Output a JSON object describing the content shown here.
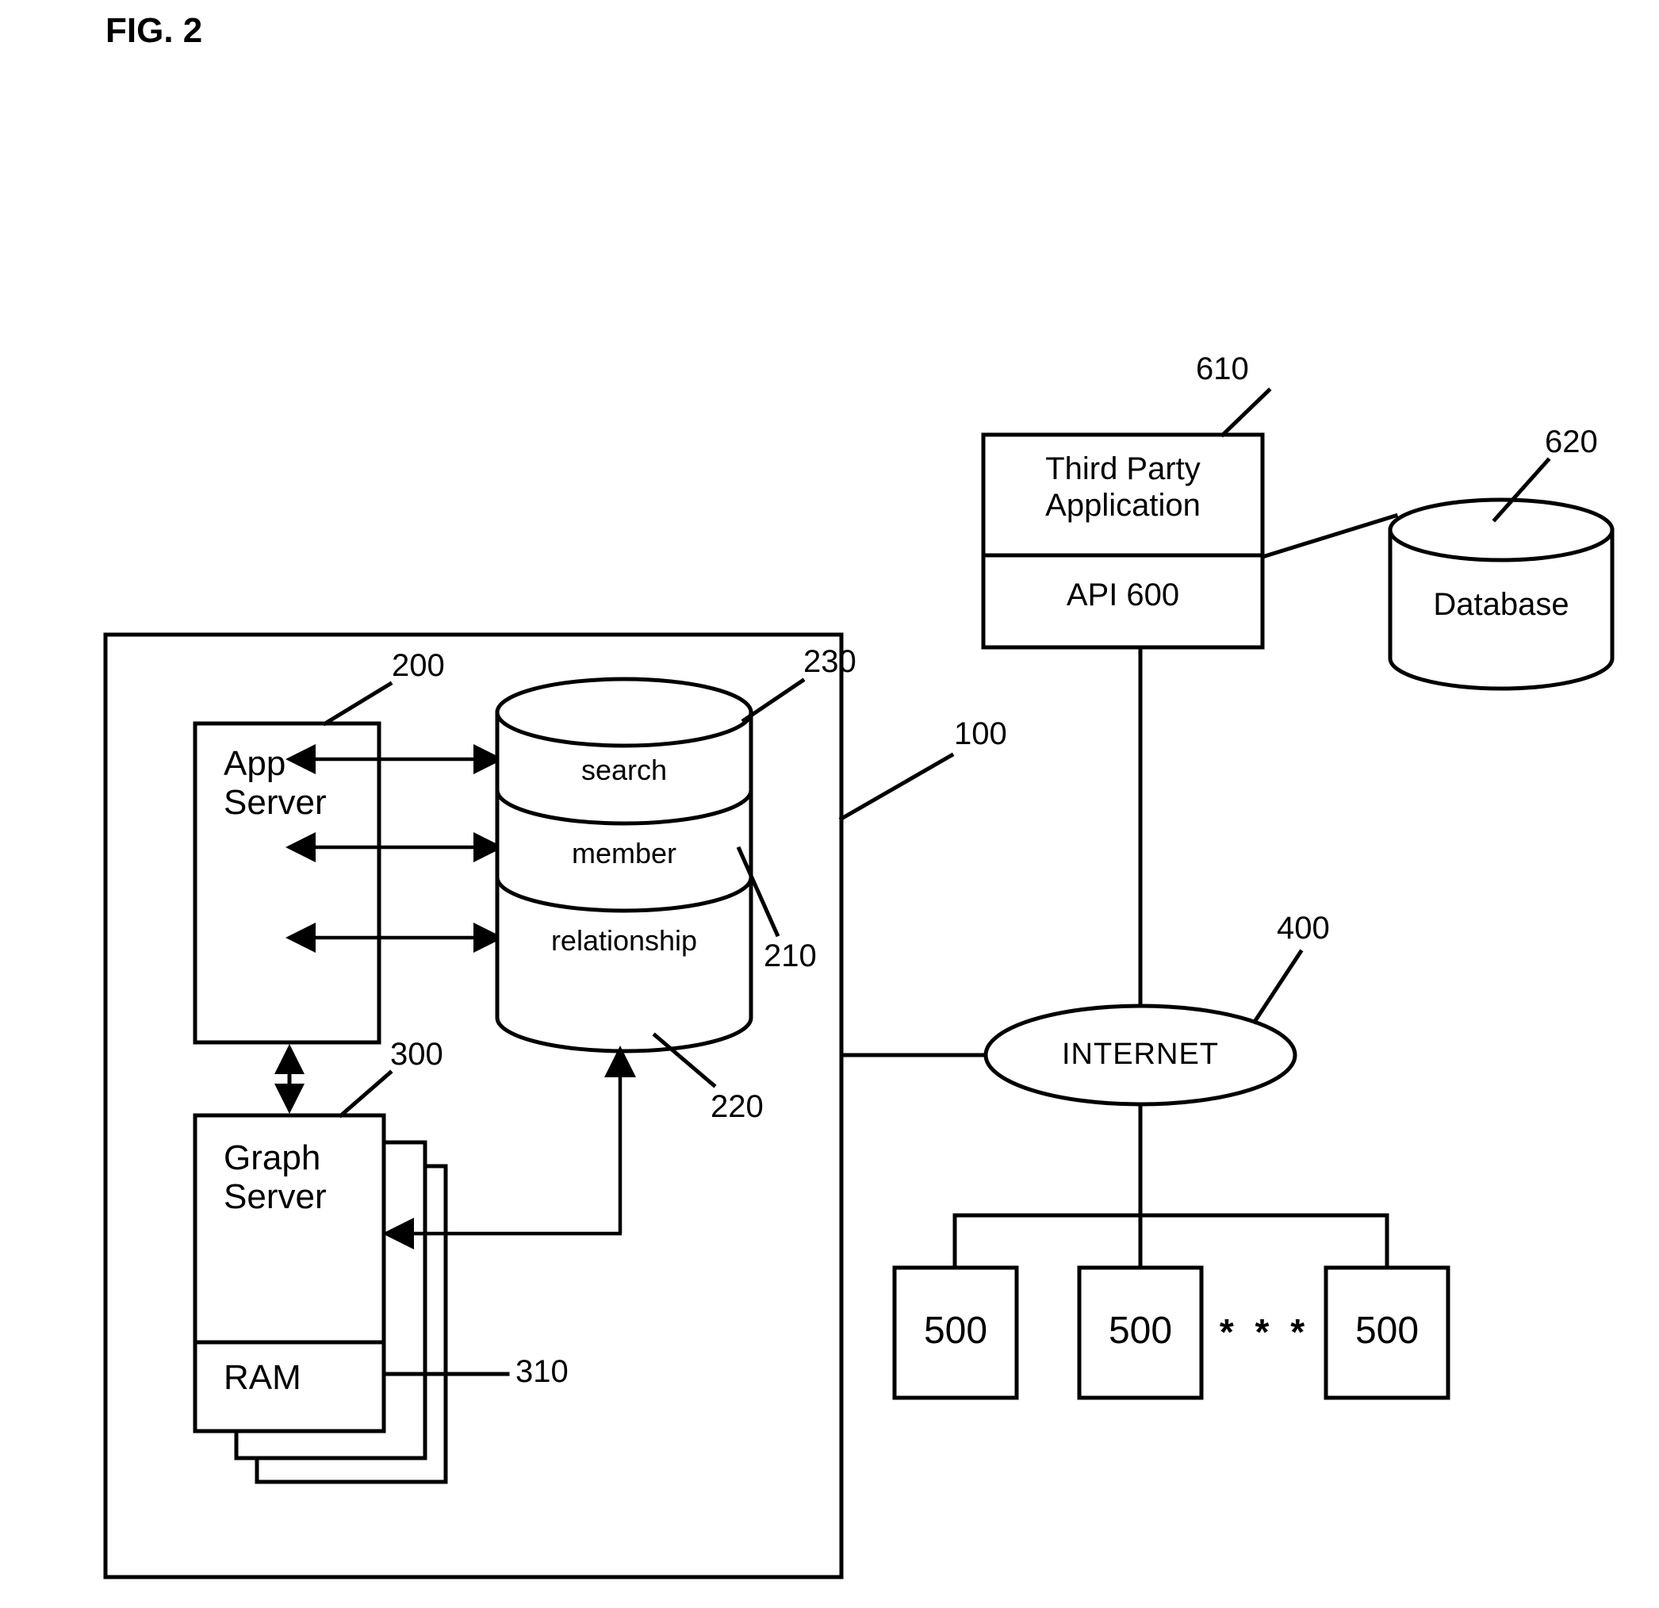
{
  "figure": {
    "title": "FIG. 2"
  },
  "system_boundary": {
    "name": "system-boundary",
    "ref": "100"
  },
  "app_server": {
    "label_line1": "App",
    "label_line2": "Server",
    "ref": "200"
  },
  "data_store": {
    "ref_member": "210",
    "ref_relationship": "220",
    "ref_search": "230",
    "layers": [
      {
        "label": "search",
        "ref": "230"
      },
      {
        "label": "member",
        "ref": "210"
      },
      {
        "label": "relationship",
        "ref": "220"
      }
    ]
  },
  "graph_server": {
    "label_line1": "Graph",
    "label_line2": "Server",
    "ref": "300",
    "ram_label": "RAM",
    "ram_ref": "310"
  },
  "third_party": {
    "label_line1": "Third Party",
    "label_line2": "Application",
    "api_label": "API 600",
    "ref": "610"
  },
  "database": {
    "label": "Database",
    "ref": "620"
  },
  "internet": {
    "label": "INTERNET",
    "ref": "400"
  },
  "clients": {
    "ellipsis": "* * *",
    "items": [
      {
        "label": "500"
      },
      {
        "label": "500"
      },
      {
        "label": "500"
      }
    ]
  },
  "colors": {
    "stroke": "#000000",
    "background": "#ffffff"
  }
}
